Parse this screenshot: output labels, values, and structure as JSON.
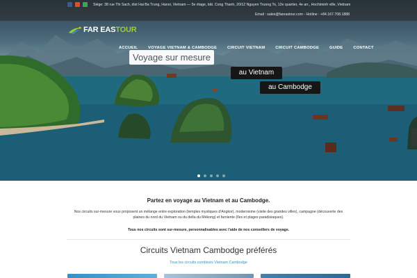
{
  "topbar": {
    "address": "Siège: 38 rue Thi Sach, dist Hai Ba Trung, Hanoi, Vietnam — 5e étage, bât. Cong Thanh, 20/12 Nguyen Truong To, 12e quartier, 4e arr., Hochiminh ville, Vietnam",
    "contact": "Email : sales@fareastour.com - Hotline : +84.167.708.1888",
    "social": [
      {
        "icon": "facebook-icon",
        "color": "#3b5998"
      },
      {
        "icon": "google-plus-icon",
        "color": "#dd4b39"
      },
      {
        "icon": "tripadvisor-icon",
        "color": "#34a853"
      }
    ]
  },
  "logo": {
    "text_main": "FAR EAS",
    "text_accent": "TOUR",
    "accent_color": "#9ccc3a"
  },
  "nav": {
    "items": [
      {
        "label": "ACCUEIL"
      },
      {
        "label": "VOYAGE VIETNAM & CAMBODGE"
      },
      {
        "label": "CIRCUIT VIETNAM"
      },
      {
        "label": "CIRCUIT CAMBODGE"
      },
      {
        "label": "GUIDE"
      },
      {
        "label": "CONTACT"
      }
    ]
  },
  "hero": {
    "slogan_line1": "Voyage sur mesure",
    "slogan_line2": "au Vietnam",
    "slogan_line3": "au Cambodge",
    "slide_count": 5,
    "active_slide": 1
  },
  "intro": {
    "title": "Partez en voyage au Vietnam et au Cambodge.",
    "text": "Nos circuits sur-mesure vous proposent un mélange entre exploration (temples mystiques d'Angkor), modernisme (visite des grandes villes), campagne (découverte des plaines du nord du Vietnam ou du delta du Mékong) et farniente (îles et plages paradisiaques).",
    "bold_text": "Tous nos circuits sont sur-mesure, personnalisables avec l'aide de nos conseillers de voyage."
  },
  "section": {
    "title": "Circuits Vietnam Cambodge préférés",
    "link": "Tous les circuits combinés Vietnam Cambodge"
  },
  "colors": {
    "link": "#3c8dbc",
    "slogan_dark": "#161616"
  }
}
